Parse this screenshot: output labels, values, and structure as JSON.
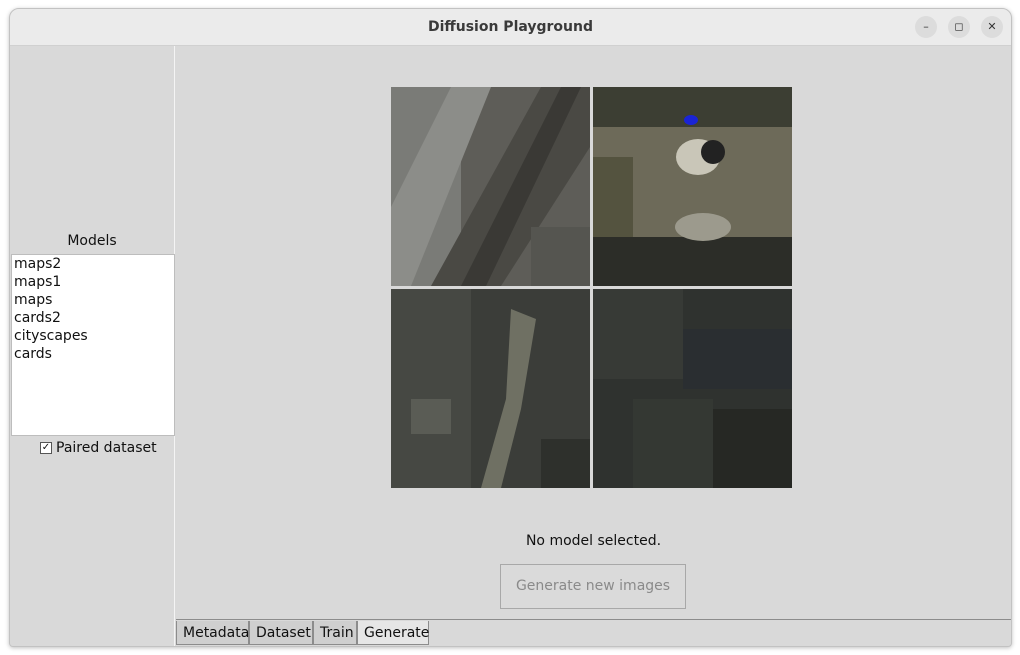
{
  "window": {
    "title": "Diffusion Playground"
  },
  "window_controls": {
    "minimize": "–",
    "maximize": "◻",
    "close": "✕"
  },
  "sidebar": {
    "models_label": "Models",
    "models": [
      "maps2",
      "maps1",
      "maps",
      "cards2",
      "cityscapes",
      "cards"
    ],
    "paired_dataset": {
      "label": "Paired dataset",
      "checked": true
    }
  },
  "main": {
    "status": "No model selected.",
    "generate_button": "Generate new images",
    "generate_enabled": false,
    "image_grid": [
      "generated-image-1",
      "generated-image-2",
      "generated-image-3",
      "generated-image-4"
    ]
  },
  "tabs": [
    {
      "label": "Metadata",
      "active": false
    },
    {
      "label": "Dataset",
      "active": false
    },
    {
      "label": "Train",
      "active": false
    },
    {
      "label": "Generate",
      "active": true
    }
  ]
}
